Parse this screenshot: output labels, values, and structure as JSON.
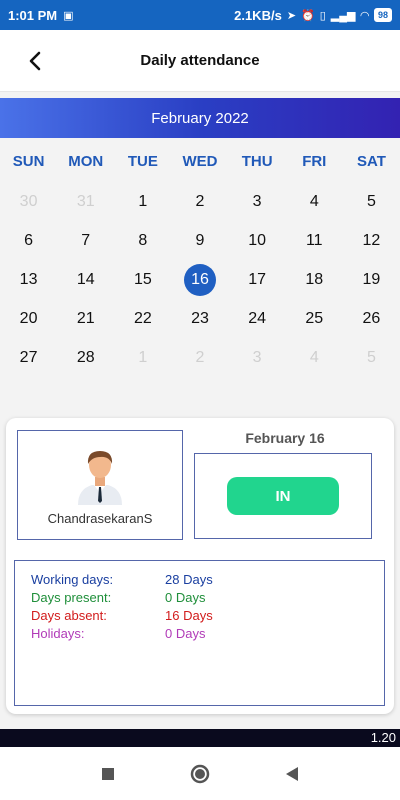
{
  "status_bar": {
    "time": "1:01 PM",
    "speed": "2.1KB/s",
    "network": "4G",
    "battery": "98"
  },
  "app_bar": {
    "title": "Daily attendance"
  },
  "calendar": {
    "month_label": "February 2022",
    "weekdays": [
      "SUN",
      "MON",
      "TUE",
      "WED",
      "THU",
      "FRI",
      "SAT"
    ],
    "weeks": [
      [
        {
          "d": "30",
          "muted": true
        },
        {
          "d": "31",
          "muted": true
        },
        {
          "d": "1"
        },
        {
          "d": "2"
        },
        {
          "d": "3"
        },
        {
          "d": "4"
        },
        {
          "d": "5"
        }
      ],
      [
        {
          "d": "6"
        },
        {
          "d": "7"
        },
        {
          "d": "8"
        },
        {
          "d": "9"
        },
        {
          "d": "10"
        },
        {
          "d": "11"
        },
        {
          "d": "12"
        }
      ],
      [
        {
          "d": "13"
        },
        {
          "d": "14"
        },
        {
          "d": "15"
        },
        {
          "d": "16",
          "selected": true
        },
        {
          "d": "17"
        },
        {
          "d": "18"
        },
        {
          "d": "19"
        }
      ],
      [
        {
          "d": "20"
        },
        {
          "d": "21"
        },
        {
          "d": "22"
        },
        {
          "d": "23"
        },
        {
          "d": "24"
        },
        {
          "d": "25"
        },
        {
          "d": "26"
        }
      ],
      [
        {
          "d": "27"
        },
        {
          "d": "28"
        },
        {
          "d": "1",
          "muted": true
        },
        {
          "d": "2",
          "muted": true
        },
        {
          "d": "3",
          "muted": true
        },
        {
          "d": "4",
          "muted": true
        },
        {
          "d": "5",
          "muted": true
        }
      ]
    ]
  },
  "card": {
    "profile_name": "ChandrasekaranS",
    "date_label": "February 16",
    "status_button": "IN",
    "stats": [
      {
        "label": "Working days:",
        "value": "28 Days",
        "color": "#1a3fa0"
      },
      {
        "label": "Days present:",
        "value": "0 Days",
        "color": "#1f8f3a"
      },
      {
        "label": "Days absent:",
        "value": "16 Days",
        "color": "#d21c1c"
      },
      {
        "label": "Holidays:",
        "value": "0 Days",
        "color": "#b13bb8"
      }
    ]
  },
  "version": "1.20",
  "colors": {
    "status_bar": "#1565c0",
    "accent": "#1f5fc2",
    "in_button": "#21d58e"
  }
}
